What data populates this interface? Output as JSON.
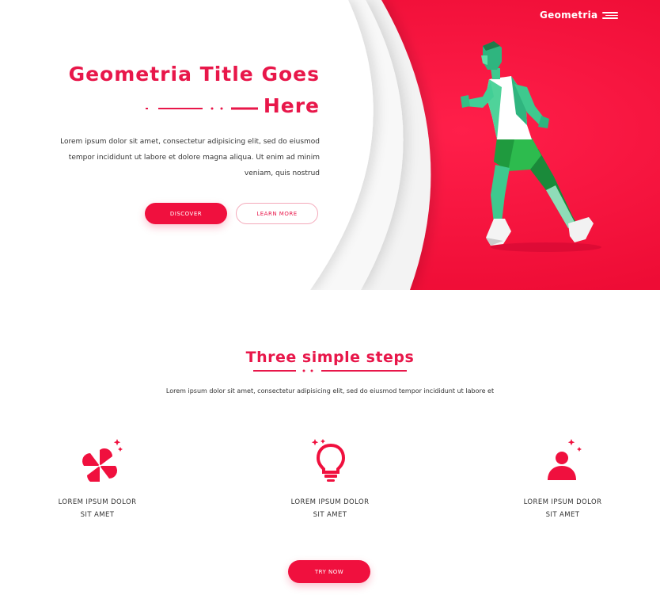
{
  "brand": {
    "name": "Geometria"
  },
  "hero": {
    "title_line1": "Geometria Title Goes",
    "title_line2": "Here",
    "text": "Lorem ipsum dolor sit amet, consectetur adipisicing elit, sed do eiusmod tempor incididunt ut labore et dolore magna aliqua. Ut enim ad minim veniam, quis nostrud",
    "learn_more_label": "LEARN MORE",
    "discover_label": "DISCOVER"
  },
  "steps": {
    "title": "Three simple steps",
    "subtitle": "Lorem ipsum dolor sit amet, consectetur adipisicing elit, sed do eiusmod tempor incididunt ut labore et",
    "items": [
      {
        "icon": "pinwheel-icon",
        "line1": "LOREM IPSUM DOLOR",
        "line2": "SIT AMET"
      },
      {
        "icon": "lightbulb-icon",
        "line1": "LOREM IPSUM DOLOR",
        "line2": "SIT AMET"
      },
      {
        "icon": "user-icon",
        "line1": "LOREM IPSUM DOLOR",
        "line2": "SIT AMET"
      }
    ],
    "try_now_label": "TRY NOW"
  },
  "colors": {
    "accent": "#f0103e",
    "title": "#e8174a",
    "text": "#333333"
  }
}
